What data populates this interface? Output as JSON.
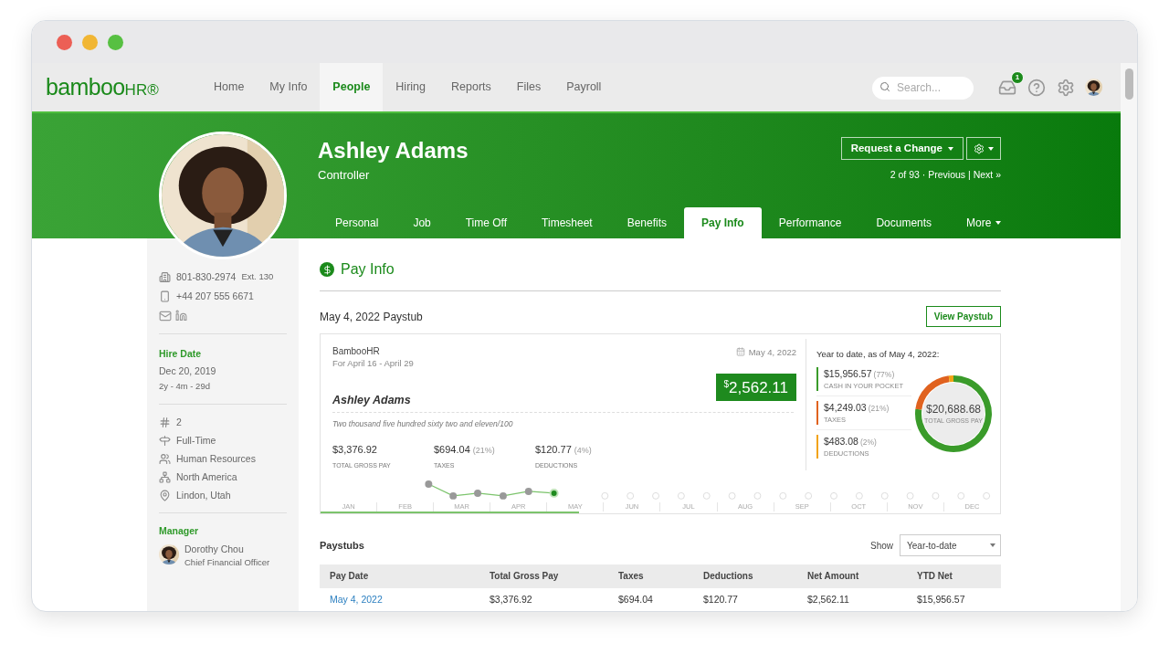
{
  "logo": {
    "text": "bamboo",
    "suffix": "HR®"
  },
  "nav": [
    {
      "label": "Home",
      "selected": false
    },
    {
      "label": "My Info",
      "selected": false
    },
    {
      "label": "People",
      "selected": true
    },
    {
      "label": "Hiring",
      "selected": false
    },
    {
      "label": "Reports",
      "selected": false
    },
    {
      "label": "Files",
      "selected": false
    },
    {
      "label": "Payroll",
      "selected": false
    }
  ],
  "search": {
    "placeholder": "Search..."
  },
  "inbox_badge": "1",
  "employee": {
    "name": "Ashley Adams",
    "title": "Controller"
  },
  "header_actions": {
    "request": "Request a Change",
    "pager": "2 of 93 · ",
    "previous": "Previous",
    "separator": " | ",
    "next": "Next »"
  },
  "tabs": [
    {
      "label": "Personal",
      "selected": false
    },
    {
      "label": "Job",
      "selected": false
    },
    {
      "label": "Time Off",
      "selected": false
    },
    {
      "label": "Timesheet",
      "selected": false
    },
    {
      "label": "Benefits",
      "selected": false
    },
    {
      "label": "Pay Info",
      "selected": true
    },
    {
      "label": "Performance",
      "selected": false
    },
    {
      "label": "Documents",
      "selected": false
    },
    {
      "label": "More",
      "selected": false
    }
  ],
  "contact": [
    {
      "kind": "office",
      "text": "801-830-2974",
      "extra": "Ext. 130"
    },
    {
      "kind": "mobile",
      "text": "+44 207 555 6671"
    }
  ],
  "hire": {
    "label": "Hire Date",
    "date": "Dec 20, 2019",
    "tenure": "2y - 4m - 29d"
  },
  "details": [
    {
      "kind": "number",
      "text": "2"
    },
    {
      "kind": "type",
      "text": "Full-Time"
    },
    {
      "kind": "department",
      "text": "Human Resources"
    },
    {
      "kind": "division",
      "text": "North America"
    },
    {
      "kind": "location",
      "text": "Lindon, Utah"
    }
  ],
  "manager": {
    "label": "Manager",
    "name": "Dorothy Chou",
    "title": "Chief Financial Officer"
  },
  "page_title": "Pay Info",
  "paystub": {
    "title": "May 4, 2022 Paystub",
    "view_button": "View Paystub",
    "company": "BambooHR",
    "period": "For April 16 - April 29",
    "date": "May 4, 2022",
    "currency": "$",
    "net": "2,562.11",
    "payee": "Ashley Adams",
    "words": "Two thousand five hundred sixty two and eleven/100",
    "stats": [
      {
        "value": "$3,376.92",
        "label": "TOTAL GROSS PAY"
      },
      {
        "value": "$694.04",
        "pct": "(21%)",
        "label": "TAXES"
      },
      {
        "value": "$120.77",
        "pct": "(4%)",
        "label": "DEDUCTIONS"
      }
    ]
  },
  "months": [
    "JAN",
    "FEB",
    "MAR",
    "APR",
    "MAY",
    "JUN",
    "JUL",
    "AUG",
    "SEP",
    "OCT",
    "NOV",
    "DEC"
  ],
  "year_progress": {
    "level": 0.38
  },
  "ytd": {
    "title": "Year to date, as of May 4, 2022:",
    "total": "$20,688.68",
    "total_label": "TOTAL GROSS PAY",
    "items": [
      {
        "value": "$15,956.57",
        "pct": "(77%)",
        "color": "#3a9b2a"
      },
      {
        "value": "$4,249.03",
        "pct": "(21%)",
        "color": "#e0621f"
      },
      {
        "value": "$483.08",
        "pct": "(2%)",
        "color": "#f2a316"
      }
    ],
    "chart_data": {
      "type": "donut",
      "categories": [
        "CASH IN YOUR POCKET",
        "TAXES",
        "DEDUCTIONS"
      ],
      "values": [
        77,
        21,
        2
      ]
    }
  },
  "paystubs": {
    "title": "Paystubs",
    "show_label": "Show",
    "filter": "Year-to-date",
    "columns": [
      "Pay Date",
      "Total Gross Pay",
      "Taxes",
      "Deductions",
      "Net Amount",
      "YTD Net"
    ],
    "rows": [
      [
        "May 4, 2022",
        "$3,376.92",
        "$694.04",
        "$120.77",
        "$2,562.11",
        "$15,956.57"
      ]
    ]
  }
}
